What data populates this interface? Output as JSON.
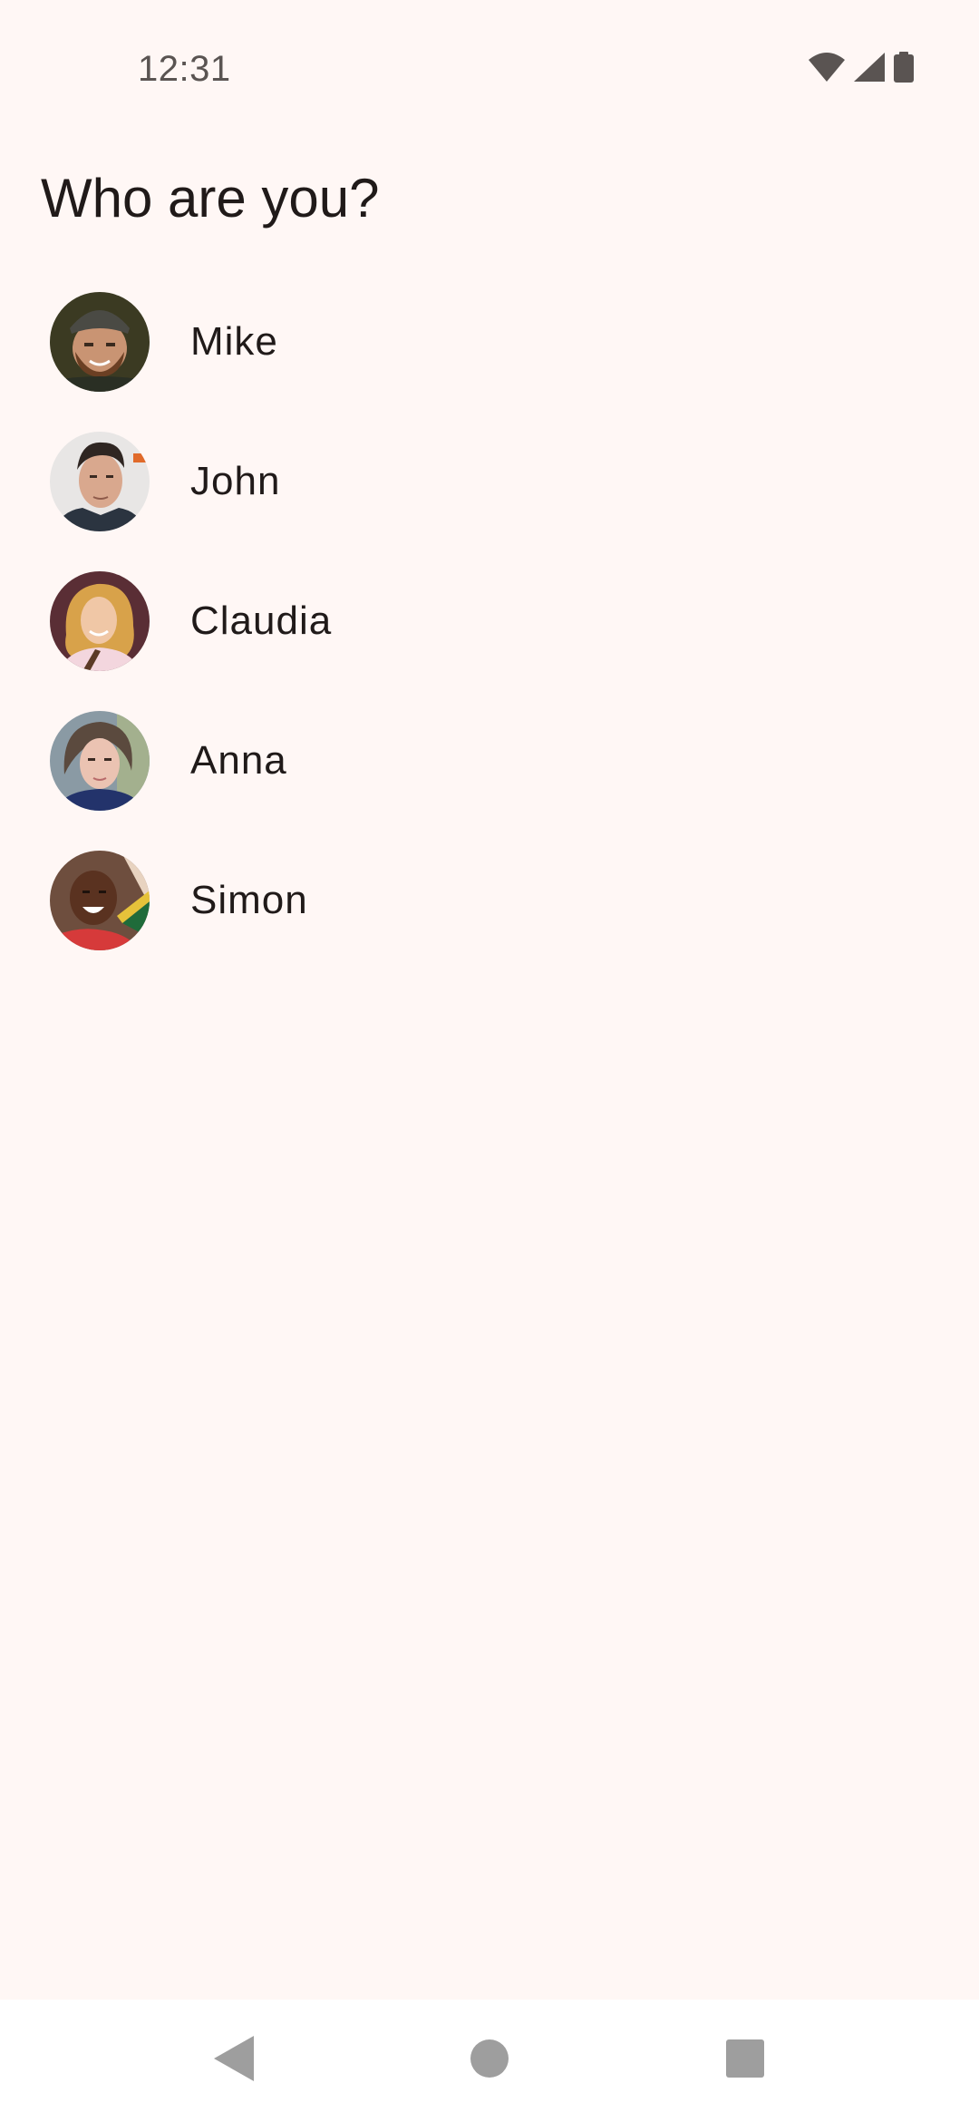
{
  "status_bar": {
    "time": "12:31",
    "icons": [
      "wifi-icon",
      "cell-signal-icon",
      "battery-icon"
    ]
  },
  "page": {
    "title": "Who are you?"
  },
  "users": [
    {
      "name": "Mike",
      "avatar": "avatar-mike"
    },
    {
      "name": "John",
      "avatar": "avatar-john"
    },
    {
      "name": "Claudia",
      "avatar": "avatar-claudia"
    },
    {
      "name": "Anna",
      "avatar": "avatar-anna"
    },
    {
      "name": "Simon",
      "avatar": "avatar-simon"
    }
  ],
  "navigation_bar": {
    "buttons": [
      "back-icon",
      "home-icon",
      "recents-icon"
    ]
  },
  "colors": {
    "background": "#FFF7F5",
    "text": "#201A19",
    "nav_background": "#FFFFFF",
    "nav_icon": "#9E9E9E"
  }
}
